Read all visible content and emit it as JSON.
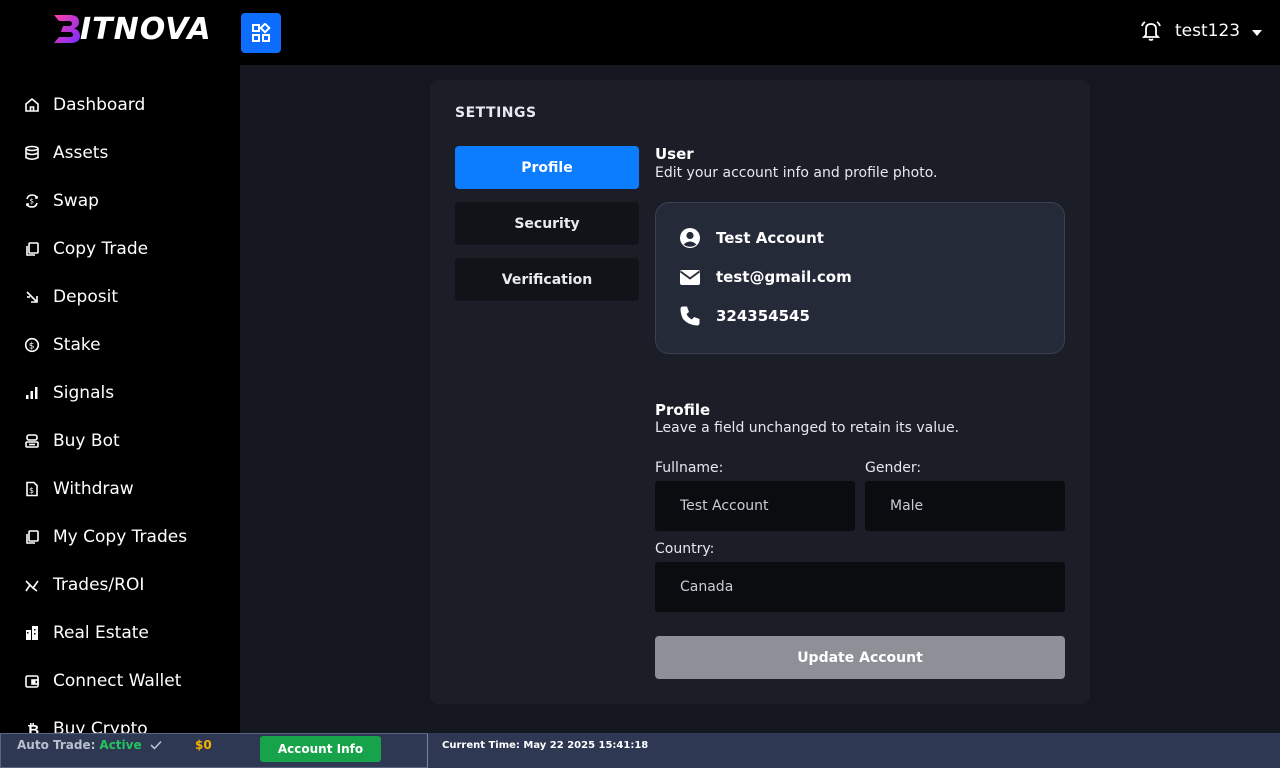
{
  "brand": {
    "logo_text": "ITNOVA",
    "logo_letter": "B"
  },
  "header": {
    "username": "test123"
  },
  "sidebar": {
    "items": [
      {
        "label": "Dashboard",
        "icon": "home-icon"
      },
      {
        "label": "Assets",
        "icon": "database-icon"
      },
      {
        "label": "Swap",
        "icon": "swap-icon"
      },
      {
        "label": "Copy Trade",
        "icon": "copy-icon"
      },
      {
        "label": "Deposit",
        "icon": "deposit-icon"
      },
      {
        "label": "Stake",
        "icon": "dollar-circle-icon"
      },
      {
        "label": "Signals",
        "icon": "bar-chart-icon"
      },
      {
        "label": "Buy Bot",
        "icon": "bot-icon"
      },
      {
        "label": "Withdraw",
        "icon": "withdraw-icon"
      },
      {
        "label": "My Copy Trades",
        "icon": "copy-icon"
      },
      {
        "label": "Trades/ROI",
        "icon": "chart-line-icon"
      },
      {
        "label": "Real Estate",
        "icon": "building-icon"
      },
      {
        "label": "Connect Wallet",
        "icon": "wallet-icon"
      },
      {
        "label": "Buy Crypto",
        "icon": "bitcoin-icon"
      }
    ]
  },
  "settings": {
    "title": "SETTINGS",
    "tabs": [
      {
        "label": "Profile",
        "active": true
      },
      {
        "label": "Security",
        "active": false
      },
      {
        "label": "Verification",
        "active": false
      }
    ],
    "user_section": {
      "heading": "User",
      "subtitle": "Edit your account info and profile photo.",
      "name": "Test Account",
      "email": "test@gmail.com",
      "phone": "324354545"
    },
    "profile_section": {
      "heading": "Profile",
      "subtitle": "Leave a field unchanged to retain its value.",
      "fullname_label": "Fullname:",
      "fullname_value": "Test Account",
      "gender_label": "Gender:",
      "gender_value": "Male",
      "country_label": "Country:",
      "country_value": "Canada",
      "update_label": "Update Account"
    }
  },
  "footer": {
    "auto_trade_label": "Auto Trade:",
    "auto_trade_status": "Active",
    "amount": "$0",
    "account_info_label": "Account Info",
    "current_time": "Current Time: May 22 2025 15:41:18"
  },
  "colors": {
    "accent": "#0d7dff",
    "success": "#16a34a",
    "warning": "#f5b300"
  }
}
